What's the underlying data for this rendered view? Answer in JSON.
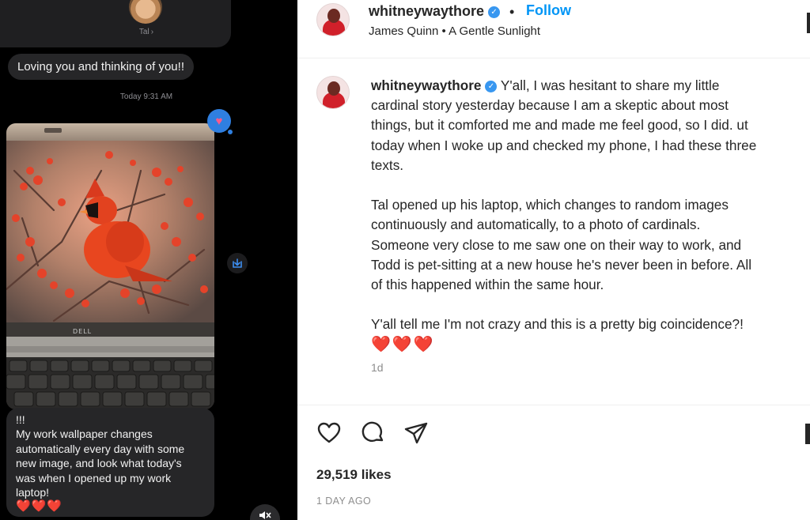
{
  "media": {
    "contact_name": "Tal",
    "messages": {
      "text_1": "Loving you and thinking of you!!",
      "time": "Today 9:31 AM",
      "reply_lines": [
        "!!!",
        "My work wallpaper changes",
        "automatically every day with some",
        "new image, and look what today's",
        "was when I opened up my work",
        "laptop!"
      ],
      "reply_hearts": "❤️❤️❤️"
    },
    "laptop_brand": "DELL",
    "icons": [
      "heart-reaction-icon",
      "save-icon",
      "mute-icon"
    ]
  },
  "post": {
    "header": {
      "username": "whitneywaythore",
      "follow_label": "Follow",
      "audio": "James Quinn • A Gentle Sunlight"
    },
    "caption": {
      "username": "whitneywaythore",
      "lines": [
        "Y'all, I was hesitant to share my little",
        "cardinal story yesterday because I am a skeptic about most",
        "things, but it comforted me and made me feel good, so I did. ut",
        "today when I woke up and checked my phone, I had these three",
        "texts."
      ],
      "paragraph_2": [
        "Tal opened up his laptop, which changes to random images",
        "continuously and automatically, to a photo of cardinals.",
        "Someone very close to me saw one on their way to work, and",
        "Todd is pet-sitting at a new house he's never been in before. All",
        "of this happened within the same hour."
      ],
      "paragraph_3": "Y'all tell me I'm not crazy and this is a pretty big coincidence?!",
      "hearts": "❤️❤️❤️",
      "time": "1d"
    },
    "likes": "29,519 likes",
    "posted": "1 DAY AGO",
    "action_icons": [
      "heart-icon",
      "comment-icon",
      "share-icon",
      "bookmark-icon"
    ],
    "colors": {
      "accent": "#0095f6",
      "verified": "#3897f0",
      "heart": "#e0245e"
    }
  }
}
